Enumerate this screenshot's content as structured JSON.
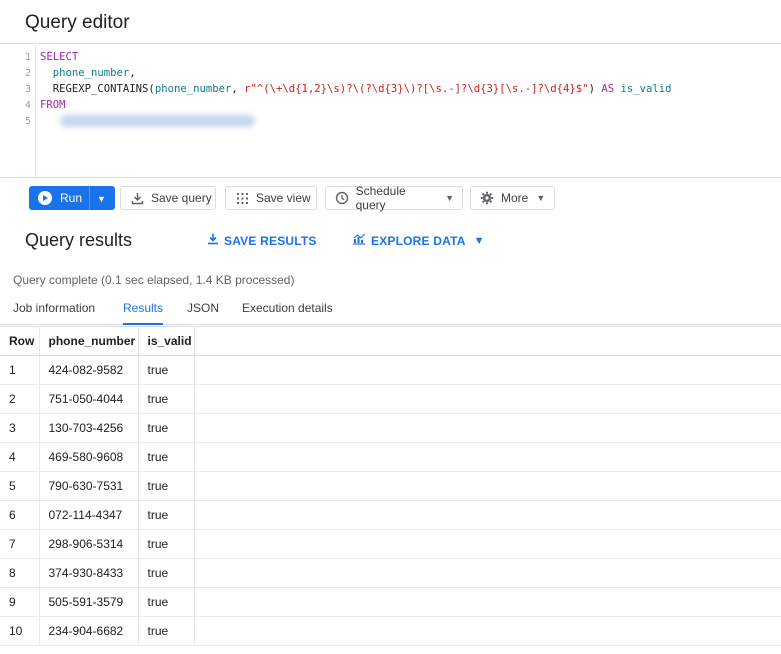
{
  "editor": {
    "title": "Query editor",
    "line_numbers": [
      "1",
      "2",
      "3",
      "4",
      "5"
    ],
    "code": {
      "l1_kw": "SELECT",
      "l2_ident": "phone_number",
      "l2_punct": ",",
      "l3_fn": "REGEXP_CONTAINS(",
      "l3_arg": "phone_number",
      "l3_comma": ", ",
      "l3_str": "r\"^(\\+\\d{1,2}\\s)?\\(?\\d{3}\\)?[\\s.-]?\\d{3}[\\s.-]?\\d{4}$\"",
      "l3_close": ") ",
      "l3_as": "AS",
      "l3_alias": "is_valid",
      "l4_kw": "FROM"
    }
  },
  "toolbar": {
    "run_label": "Run",
    "save_query_label": "Save query",
    "save_view_label": "Save view",
    "schedule_query_label": "Schedule query",
    "more_label": "More"
  },
  "results": {
    "title": "Query results",
    "save_results_label": "SAVE RESULTS",
    "explore_data_label": "EXPLORE DATA",
    "status": "Query complete (0.1 sec elapsed, 1.4 KB processed)",
    "tabs": [
      "Job information",
      "Results",
      "JSON",
      "Execution details"
    ],
    "active_tab": "Results",
    "columns": [
      "Row",
      "phone_number",
      "is_valid"
    ],
    "rows": [
      [
        "1",
        "424-082-9582",
        "true"
      ],
      [
        "2",
        "751-050-4044",
        "true"
      ],
      [
        "3",
        "130-703-4256",
        "true"
      ],
      [
        "4",
        "469-580-9608",
        "true"
      ],
      [
        "5",
        "790-630-7531",
        "true"
      ],
      [
        "6",
        "072-114-4347",
        "true"
      ],
      [
        "7",
        "298-906-5314",
        "true"
      ],
      [
        "8",
        "374-930-8433",
        "true"
      ],
      [
        "9",
        "505-591-3579",
        "true"
      ],
      [
        "10",
        "234-904-6682",
        "true"
      ]
    ]
  },
  "colors": {
    "accent": "#1a73e8",
    "keyword": "#9c27b0",
    "string": "#c5221f",
    "identifier": "#0d7c8c"
  }
}
